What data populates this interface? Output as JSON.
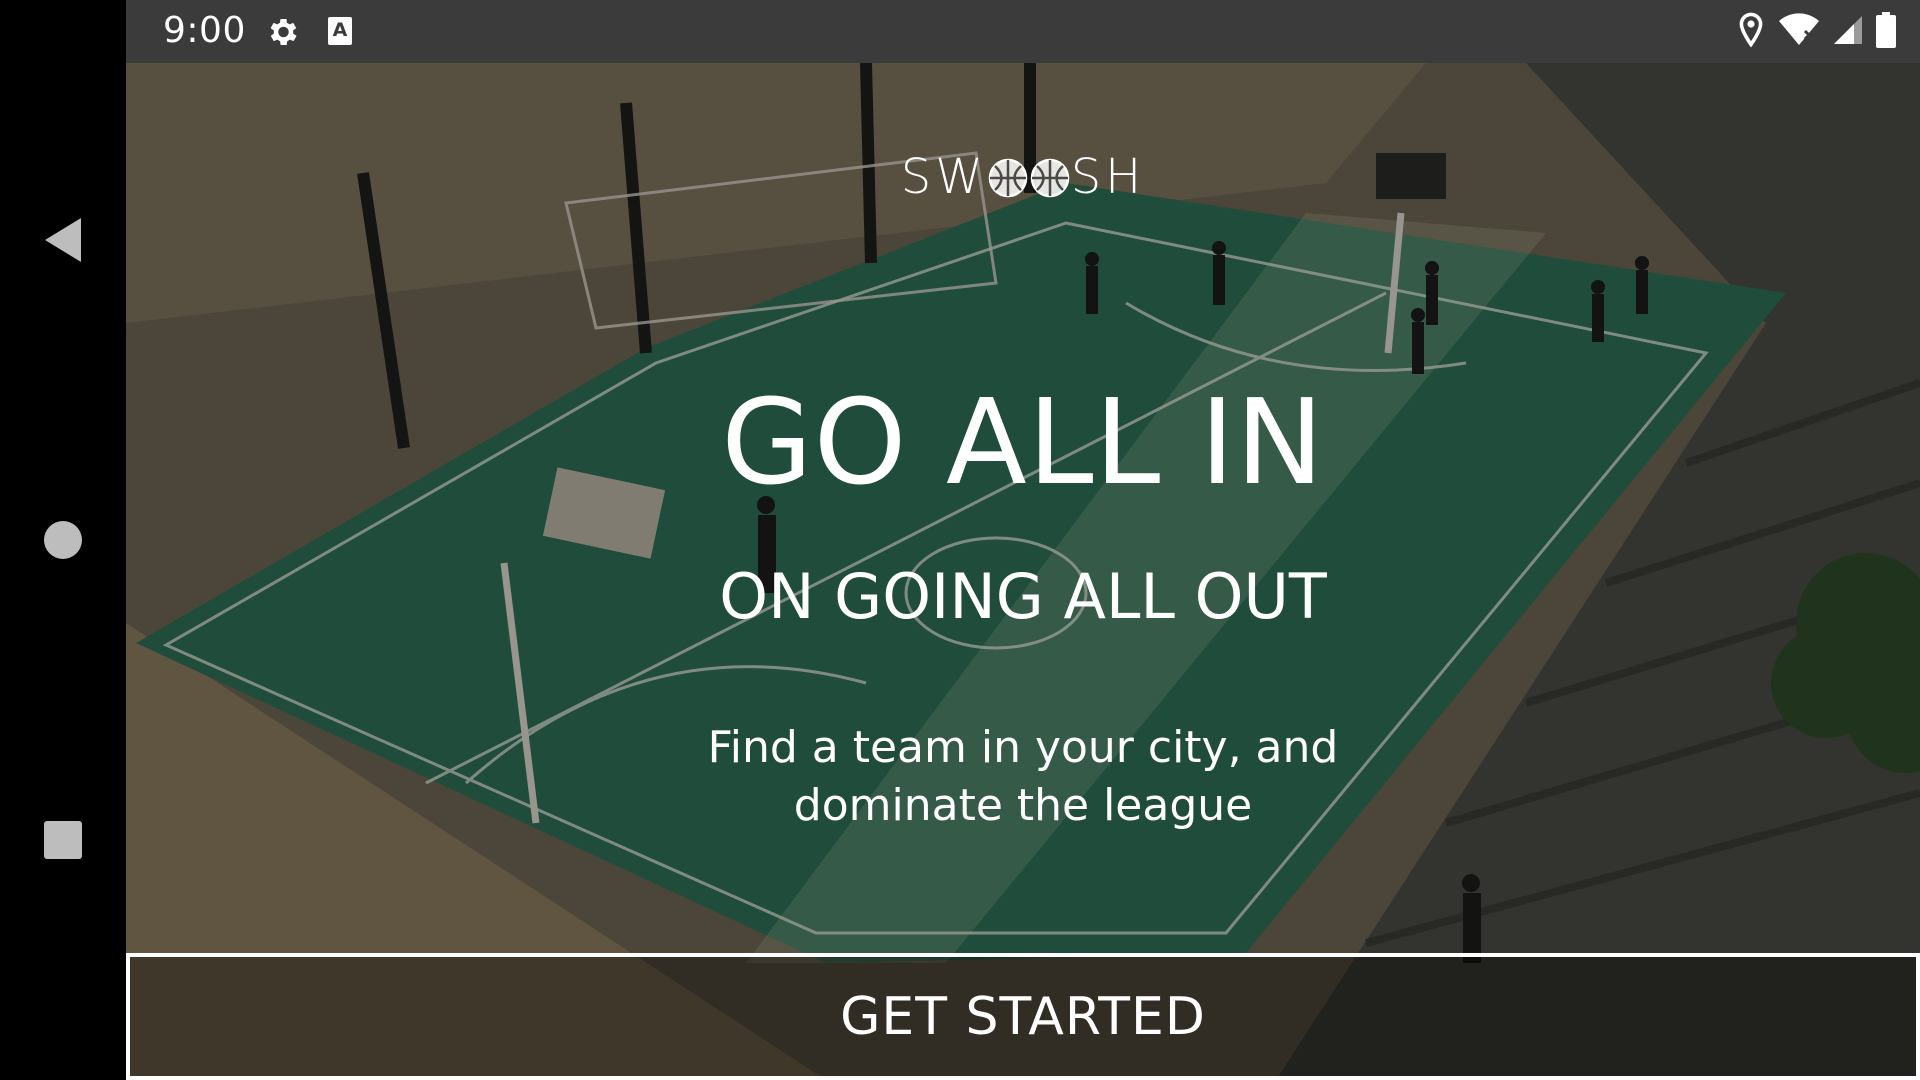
{
  "status_bar": {
    "time": "9:00",
    "icons": [
      "gear-icon",
      "a-icon",
      "location-icon",
      "wifi-icon",
      "signal-icon",
      "battery-icon"
    ],
    "a_label": "A"
  },
  "navigation": {
    "back_icon": "back-triangle-icon",
    "home_icon": "home-circle-icon",
    "recents_icon": "recents-square-icon"
  },
  "hero": {
    "logo_text_left": "SW",
    "logo_text_right": "SH",
    "headline": "GO ALL IN",
    "subheadline": "ON GOING ALL OUT",
    "tagline_line1": "Find a team in your city, and",
    "tagline_line2": "dominate the league"
  },
  "cta": {
    "label": "GET STARTED"
  },
  "colors": {
    "status_bar": "#3b3b3b",
    "nav_bar": "#000000",
    "court_green": "#2f6e55",
    "text": "#ffffff"
  }
}
